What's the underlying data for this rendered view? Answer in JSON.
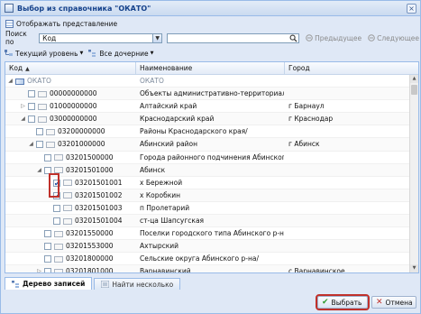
{
  "window": {
    "title": "Выбор из справочника \"ОКАТО\""
  },
  "toolbar": {
    "show_view": "Отображать представление",
    "search_by_label": "Поиск по",
    "search_field_value": "Код",
    "search_text": "",
    "prev": "Предыдущее",
    "next": "Следующее",
    "current_level": "Текущий уровень",
    "all_children": "Все дочерние"
  },
  "columns": {
    "code": "Код",
    "name": "Наименование",
    "city": "Город"
  },
  "rows": [
    {
      "code": "ОКАТО",
      "name": "ОКАТО",
      "city": ""
    },
    {
      "code": "00000000000",
      "name": "Объекты административно-территориального д",
      "city": ""
    },
    {
      "code": "01000000000",
      "name": "Алтайский край",
      "city": "г Барнаул"
    },
    {
      "code": "03000000000",
      "name": "Краснодарский край",
      "city": "г Краснодар"
    },
    {
      "code": "03200000000",
      "name": "Районы Краснодарского края/",
      "city": ""
    },
    {
      "code": "03201000000",
      "name": "Абинский район",
      "city": "г Абинск"
    },
    {
      "code": "03201500000",
      "name": "Города районного подчинения Абинского р-на/",
      "city": ""
    },
    {
      "code": "03201501000",
      "name": "Абинск",
      "city": ""
    },
    {
      "code": "03201501001",
      "name": "х Бережной",
      "city": ""
    },
    {
      "code": "03201501002",
      "name": "х Коробкин",
      "city": ""
    },
    {
      "code": "03201501003",
      "name": "п Пролетарий",
      "city": ""
    },
    {
      "code": "03201501004",
      "name": "ст-ца Шапсугская",
      "city": ""
    },
    {
      "code": "03201550000",
      "name": "Поселки городского типа Абинского р-на/",
      "city": ""
    },
    {
      "code": "03201553000",
      "name": "Ахтырский",
      "city": ""
    },
    {
      "code": "03201800000",
      "name": "Сельские округа Абинского р-на/",
      "city": ""
    },
    {
      "code": "03201801000",
      "name": "Варнавинский",
      "city": "с Варнавинское"
    }
  ],
  "tabs": {
    "tree": "Дерево записей",
    "find": "Найти несколько"
  },
  "buttons": {
    "select": "Выбрать",
    "cancel": "Отмена"
  },
  "colors": {
    "accent": "#15428b",
    "highlight": "#c0312b",
    "border": "#99bbe8"
  }
}
